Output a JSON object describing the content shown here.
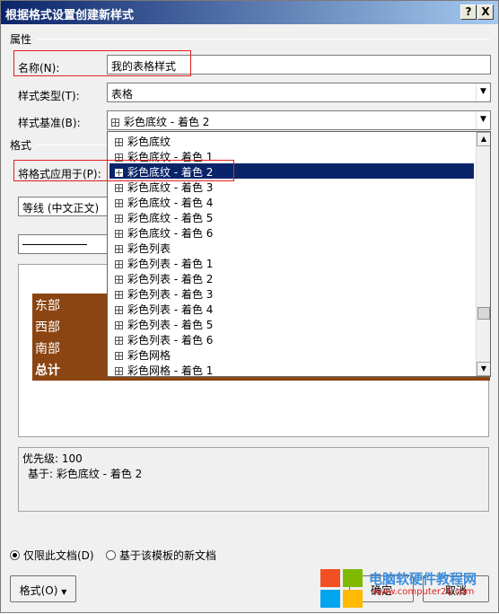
{
  "window": {
    "title": "根据格式设置创建新样式",
    "help_label": "?",
    "close_label": "X"
  },
  "properties": {
    "section_title": "属性",
    "name_label": "名称(N):",
    "name_value": "我的表格样式",
    "type_label": "样式类型(T):",
    "type_value": "表格",
    "based_label": "样式基准(B):",
    "based_value": "彩色底纹 - 着色 2"
  },
  "format": {
    "section_title": "格式",
    "apply_label": "将格式应用于(P):",
    "font_value": "等线 (中文正文)"
  },
  "dropdown": {
    "items": [
      "彩色底纹",
      "彩色底纹 - 着色 1",
      "彩色底纹 - 着色 2",
      "彩色底纹 - 着色 3",
      "彩色底纹 - 着色 4",
      "彩色底纹 - 着色 5",
      "彩色底纹 - 着色 6",
      "彩色列表",
      "彩色列表 - 着色 1",
      "彩色列表 - 着色 2",
      "彩色列表 - 着色 3",
      "彩色列表 - 着色 4",
      "彩色列表 - 着色 5",
      "彩色列表 - 着色 6",
      "彩色网格",
      "彩色网格 - 着色 1"
    ],
    "selected_index": 2
  },
  "preview": {
    "rows": [
      "东部",
      "西部",
      "南部",
      "总计"
    ],
    "fill_color": "#8b4512"
  },
  "description": {
    "priority": "优先级: 100",
    "based_on": "基于: 彩色底纹 - 着色 2"
  },
  "options": {
    "only_this_doc": "仅限此文档(D)",
    "new_docs": "基于该模板的新文档"
  },
  "buttons": {
    "format": "格式(O)",
    "ok": "确定",
    "cancel": "取消"
  },
  "watermark": {
    "text": "电脑软硬件教程网",
    "url": "www.computer26.com"
  },
  "colors": {
    "selection": "#0a246a",
    "title_bar": "#0a246a",
    "highlight_box": "#e02020"
  }
}
